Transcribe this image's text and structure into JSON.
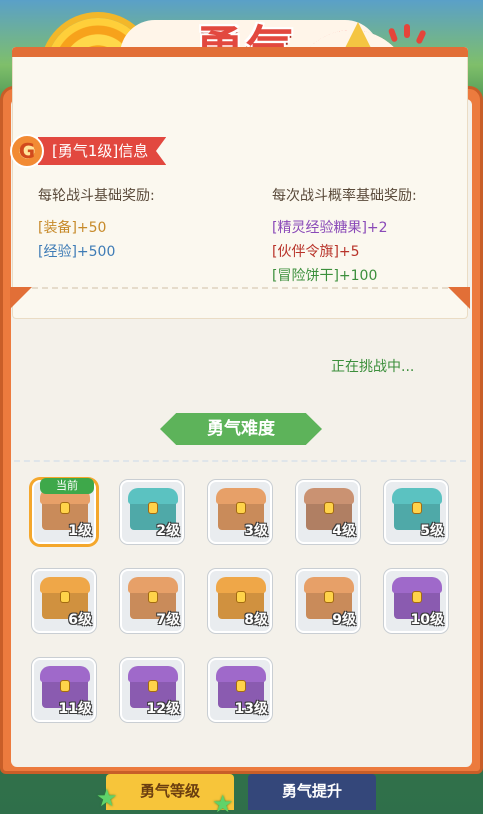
{
  "header": {
    "title": "勇气",
    "close_icon": "close-icon"
  },
  "info": {
    "level_tag": "[勇气1级]信息",
    "left_heading": "每轮战斗基础奖励:",
    "left_rewards": [
      {
        "text": "[装备]+50",
        "color": "#c78a2a"
      },
      {
        "text": "[经验]+500",
        "color": "#3f7cb6"
      }
    ],
    "right_heading": "每次战斗概率基础奖励:",
    "right_rewards": [
      {
        "text": "[精灵经验糖果]+2",
        "color": "#8a4ab8"
      },
      {
        "text": "[伙伴令旗]+5",
        "color": "#b8332a"
      },
      {
        "text": "[冒险饼干]+100",
        "color": "#3c8f3c"
      }
    ],
    "status": "正在挑战中..."
  },
  "difficulty": {
    "title": "勇气难度",
    "current_badge": "当前",
    "current_level": 1,
    "chests": [
      {
        "label": "1级",
        "color": "#c98b5a"
      },
      {
        "label": "2级",
        "color": "#4fa9a8"
      },
      {
        "label": "3级",
        "color": "#c98b5a"
      },
      {
        "label": "4级",
        "color": "#b07f63"
      },
      {
        "label": "5级",
        "color": "#4fa9a8"
      },
      {
        "label": "6级",
        "color": "#d0913f"
      },
      {
        "label": "7级",
        "color": "#c98b5a"
      },
      {
        "label": "8级",
        "color": "#d0913f"
      },
      {
        "label": "9级",
        "color": "#c98b5a"
      },
      {
        "label": "10级",
        "color": "#8a5bb0"
      },
      {
        "label": "11级",
        "color": "#8a5bb0"
      },
      {
        "label": "12级",
        "color": "#8a5bb0"
      },
      {
        "label": "13级",
        "color": "#8a5bb0"
      }
    ]
  },
  "tabs": {
    "active": "勇气等级",
    "inactive": "勇气提升"
  }
}
